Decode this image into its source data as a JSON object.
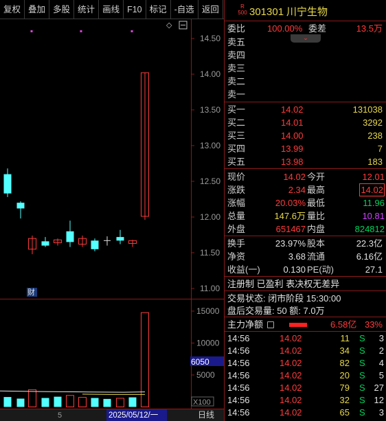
{
  "toolbar": {
    "buttons": [
      "复权",
      "叠加",
      "多股",
      "统计",
      "画线",
      "F10",
      "标记",
      "-自选",
      "返回"
    ]
  },
  "chart": {
    "price_ticks": [
      "14.50",
      "14.00",
      "13.50",
      "13.00",
      "12.50",
      "12.00",
      "11.50",
      "11.00"
    ],
    "volume_ticks": [
      "15000",
      "10000",
      "5000"
    ],
    "volume_highlight": "6050",
    "unit_label": "X100",
    "bottom_count": "5",
    "date_label": "2025/05/12/一",
    "period_label": "日线",
    "finance_marker": "财",
    "collapse_icon": "◇",
    "minus_icon": "−"
  },
  "stock": {
    "badge_top": "R",
    "badge_bottom": "500",
    "code": "301301",
    "name": "川宁生物"
  },
  "ratio": {
    "label_wb": "委比",
    "wb": "100.00%",
    "label_wc": "委差",
    "wc": "13.5万"
  },
  "asks": [
    {
      "label": "卖五",
      "price": "",
      "vol": ""
    },
    {
      "label": "卖四",
      "price": "",
      "vol": ""
    },
    {
      "label": "卖三",
      "price": "",
      "vol": ""
    },
    {
      "label": "卖二",
      "price": "",
      "vol": ""
    },
    {
      "label": "卖一",
      "price": "",
      "vol": ""
    }
  ],
  "bids": [
    {
      "label": "买一",
      "price": "14.02",
      "vol": "131038"
    },
    {
      "label": "买二",
      "price": "14.01",
      "vol": "3292"
    },
    {
      "label": "买三",
      "price": "14.00",
      "vol": "238"
    },
    {
      "label": "买四",
      "price": "13.99",
      "vol": "7"
    },
    {
      "label": "买五",
      "price": "13.98",
      "vol": "183"
    }
  ],
  "stats": [
    {
      "l1": "现价",
      "v1": "14.02",
      "l2": "今开",
      "v2": "12.01"
    },
    {
      "l1": "涨跌",
      "v1": "2.34",
      "l2": "最高",
      "v2": "14.02"
    },
    {
      "l1": "涨幅",
      "v1": "20.03%",
      "l2": "最低",
      "v2": "11.96"
    },
    {
      "l1": "总量",
      "v1": "147.6万",
      "l2": "量比",
      "v2": "10.81"
    },
    {
      "l1": "外盘",
      "v1": "651467",
      "l2": "内盘",
      "v2": "824812"
    }
  ],
  "stats2": [
    {
      "l1": "换手",
      "v1": "23.97%",
      "l2": "股本",
      "v2": "22.3亿"
    },
    {
      "l1": "净资",
      "v1": "3.68",
      "l2": "流通",
      "v2": "6.16亿"
    },
    {
      "l1": "收益(一)",
      "v1": "0.130",
      "l2": "PE(动)",
      "v2": "27.1"
    }
  ],
  "info": {
    "tags": "注册制 已盈利 表决权无差异",
    "status": "交易状态: 闭市阶段 15:30:00",
    "after": "盘后交易量: 50  额: 7.0万"
  },
  "mainflow": {
    "label": "主力净额",
    "value": "6.58亿",
    "pct": "33%"
  },
  "ticks": [
    {
      "time": "14:56",
      "price": "14.02",
      "vol": "11",
      "side": "S",
      "n": "3"
    },
    {
      "time": "14:56",
      "price": "14.02",
      "vol": "34",
      "side": "S",
      "n": "2"
    },
    {
      "time": "14:56",
      "price": "14.02",
      "vol": "82",
      "side": "S",
      "n": "4"
    },
    {
      "time": "14:56",
      "price": "14.02",
      "vol": "20",
      "side": "S",
      "n": "5"
    },
    {
      "time": "14:56",
      "price": "14.02",
      "vol": "79",
      "side": "S",
      "n": "27"
    },
    {
      "time": "14:56",
      "price": "14.02",
      "vol": "32",
      "side": "S",
      "n": "12"
    },
    {
      "time": "14:56",
      "price": "14.02",
      "vol": "65",
      "side": "S",
      "n": "3"
    }
  ],
  "colors": {
    "up": "#ff3b3b",
    "down": "#00d25b",
    "flat": "#e0e0e0",
    "axis": "#8b1a1a",
    "cyan": "#54ffff"
  }
}
